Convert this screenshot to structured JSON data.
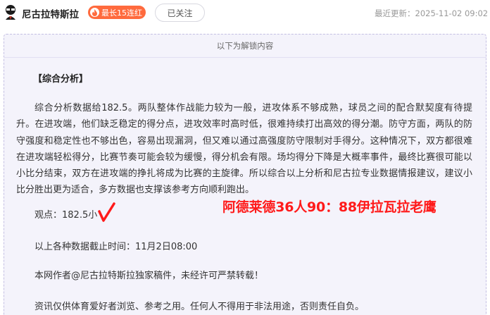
{
  "header": {
    "author_name": "尼古拉特斯拉",
    "streak_badge": "最长15连红",
    "follow_label": "已关注",
    "update_time": "最近更新：2025-11-02 09:02"
  },
  "unlock_banner": "以下为解锁内容",
  "article": {
    "section_title": "【综合分析】",
    "analysis": "综合分析数据给182.5。两队整体作战能力较为一般，进攻体系不够成熟，球员之间的配合默契度有待提升。在进攻端，他们缺乏稳定的得分点，进攻效率时高时低，很难持续打出高效的得分潮。防守方面，两队的防守强度和稳定性也不够出色，容易出现漏洞，但又难以通过高强度防守限制对手得分。这种情况下，双方都很难在进攻端轻松得分，比赛节奏可能会较为缓慢，得分机会有限。场均得分下降是大概率事件，最终比赛很可能以小比分结束，双方在进攻端的挣扎将成为比赛的主旋律。所以综合以上分析和尼古拉专业数据情报建议，建议小比分胜出更为适合，多方数据也支撑该参考方向顺利跑出。",
    "viewpoint": "观点：182.5小",
    "deadline": "以上各种数据截止时间：11月2日08:00",
    "copyright": "本网作者@尼古拉特斯拉独家稿件，未经许可严禁转载！",
    "disclaimer": "资讯仅供体育爱好者浏览、参考之用。任何人不得用于非法用途，否则责任自负。"
  },
  "overlay": {
    "result_text": "阿德莱德36人90：88伊拉瓦拉老鹰",
    "check_color": "#ff1a1a"
  },
  "colors": {
    "badge": "#ff6a3d",
    "unlock_bg": "#f4f3fb",
    "overlay_red": "#ff1a1a"
  }
}
